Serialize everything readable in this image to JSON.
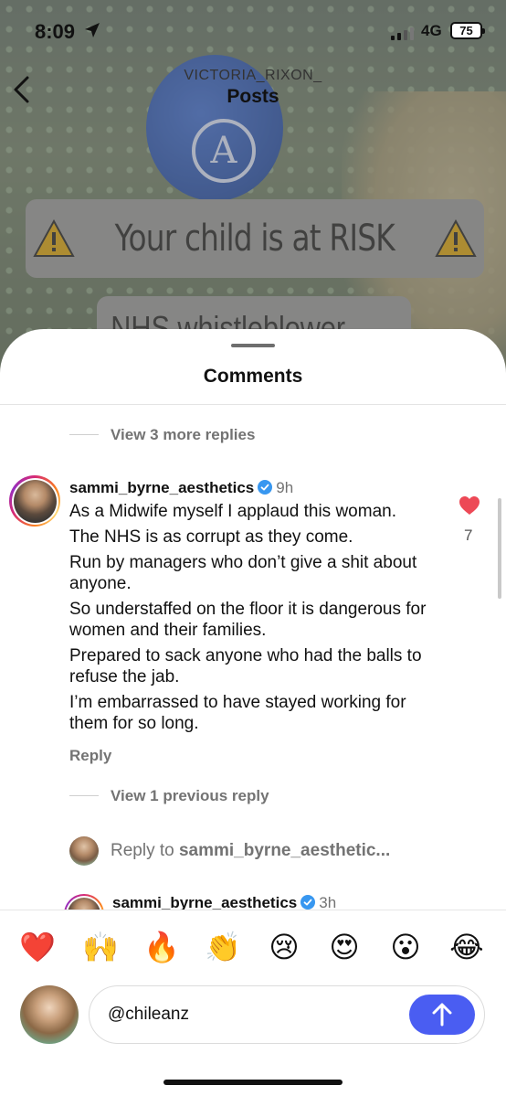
{
  "status_bar": {
    "time": "8:09",
    "network": "4G",
    "battery": "75"
  },
  "header": {
    "username": "VICTORIA_RIXON_",
    "title": "Posts"
  },
  "post_image": {
    "warning_text": "Your child is at RISK",
    "second_text": "NHS whistleblower"
  },
  "comments": {
    "title": "Comments",
    "view_more_replies": "View 3 more replies",
    "main_comment": {
      "username": "sammi_byrne_aesthetics",
      "time": "9h",
      "lines": [
        "As a Midwife myself I applaud this woman.",
        "The NHS is as corrupt as they come.",
        "Run by managers who don’t give a shit about anyone.",
        "So understaffed on the floor it is dangerous for women and their families.",
        "Prepared to sack anyone who had the balls to refuse the jab.",
        "I’m embarrassed to have stayed working for them for so long."
      ],
      "reply_label": "Reply",
      "likes": "7"
    },
    "view_previous_reply": "View 1 previous reply",
    "reply_to_prefix": "Reply to",
    "reply_to_user": "sammi_byrne_aesthetic...",
    "next_comment": {
      "username": "sammi_byrne_aesthetics",
      "time": "3h"
    }
  },
  "emoji_bar": [
    "❤️",
    "🙌",
    "🔥",
    "👏",
    "😢",
    "😍",
    "😮",
    "😂"
  ],
  "input": {
    "value": "@chileanz"
  },
  "colors": {
    "like": "#ed4956",
    "send": "#4a5df2",
    "verified": "#3897f0",
    "muted": "#737373"
  }
}
